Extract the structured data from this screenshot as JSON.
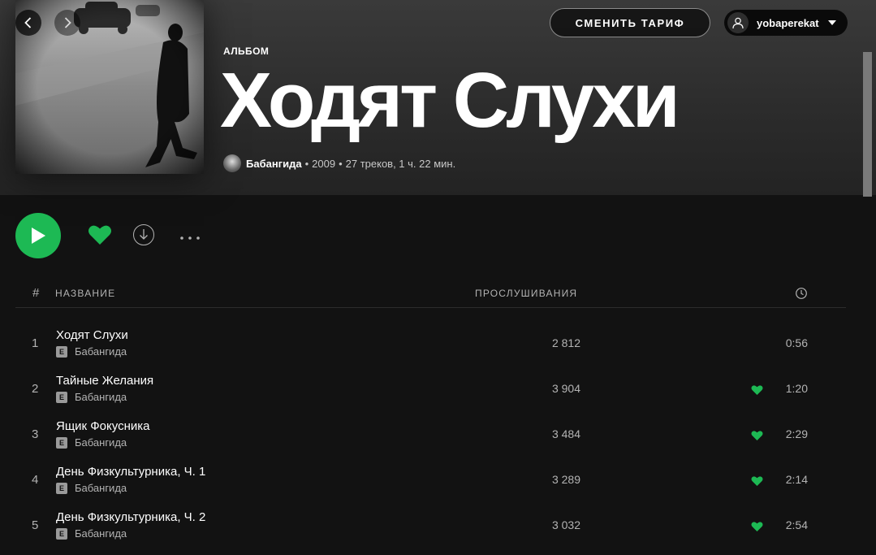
{
  "window": {
    "nav_back_label": "‹",
    "nav_forward_label": "›"
  },
  "header": {
    "upgrade_label": "СМЕНИТЬ ТАРИФ",
    "username": "yobaperekat",
    "album_type": "АЛЬБОМ",
    "album_title": "Ходят Слухи",
    "artist": "Бабангида",
    "year": "2009",
    "stats": "27 треков, 1 ч. 22 мин."
  },
  "table": {
    "col_num": "#",
    "col_title": "НАЗВАНИЕ",
    "col_plays": "ПРОСЛУШИВАНИЯ",
    "tracks": [
      {
        "num": "1",
        "title": "Ходят Слухи",
        "artist": "Бабангида",
        "explicit": "E",
        "plays": "2 812",
        "duration": "0:56",
        "liked": false
      },
      {
        "num": "2",
        "title": "Тайные Желания",
        "artist": "Бабангида",
        "explicit": "E",
        "plays": "3 904",
        "duration": "1:20",
        "liked": true
      },
      {
        "num": "3",
        "title": "Ящик Фокусника",
        "artist": "Бабангида",
        "explicit": "E",
        "plays": "3 484",
        "duration": "2:29",
        "liked": true
      },
      {
        "num": "4",
        "title": "День Физкультурника, Ч. 1",
        "artist": "Бабангида",
        "explicit": "E",
        "plays": "3 289",
        "duration": "2:14",
        "liked": true
      },
      {
        "num": "5",
        "title": "День Физкультурника, Ч. 2",
        "artist": "Бабангида",
        "explicit": "E",
        "plays": "3 032",
        "duration": "2:54",
        "liked": true
      }
    ]
  },
  "icons": {
    "back": "chevron-left-icon",
    "forward": "chevron-right-icon",
    "user": "user-icon",
    "dropdown": "caret-down-icon",
    "play": "play-icon",
    "heart": "heart-icon",
    "download": "download-icon",
    "more": "more-icon",
    "clock": "clock-icon"
  },
  "colors": {
    "accent": "#1db954",
    "background": "#121212",
    "text_secondary": "#b3b3b3"
  }
}
